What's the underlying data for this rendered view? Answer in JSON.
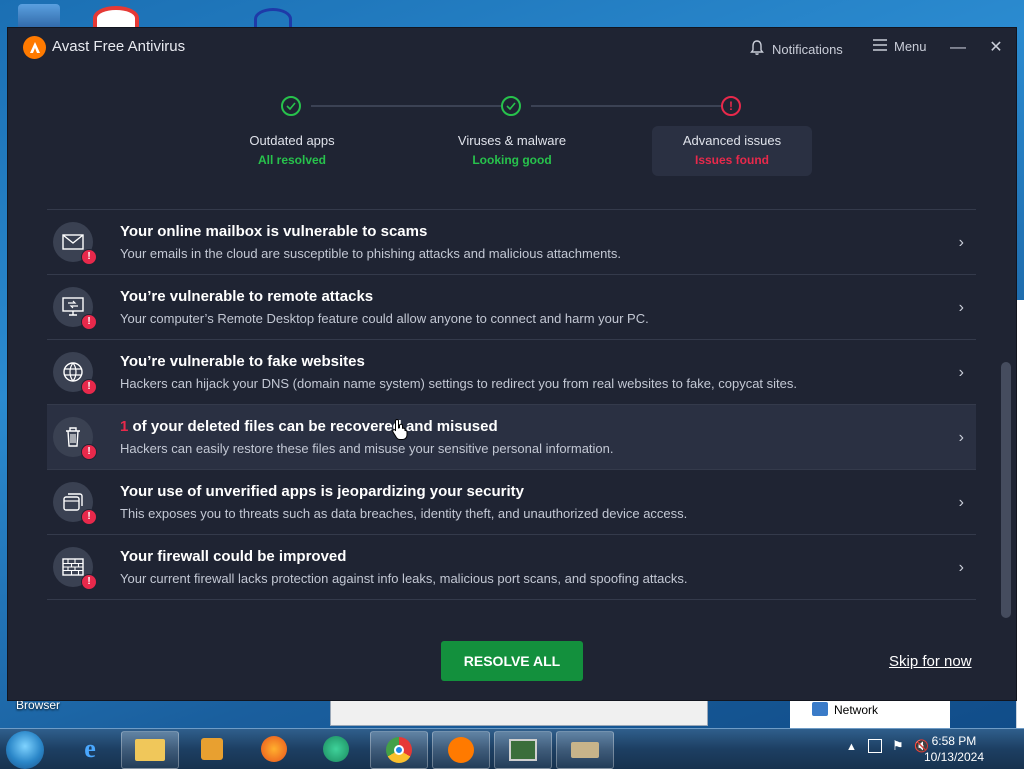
{
  "app": {
    "title": "Avast Free Antivirus",
    "notifications_label": "Notifications",
    "menu_label": "Menu"
  },
  "steps": [
    {
      "title": "Outdated apps",
      "status": "All resolved",
      "status_color": "#27c24c"
    },
    {
      "title": "Viruses & malware",
      "status": "Looking good",
      "status_color": "#27c24c"
    },
    {
      "title": "Advanced issues",
      "status": "Issues found",
      "status_color": "#e8294b"
    }
  ],
  "issues": [
    {
      "icon": "mail-icon",
      "title": "Your online mailbox is vulnerable to scams",
      "desc": "Your emails in the cloud are susceptible to phishing attacks and malicious attachments."
    },
    {
      "icon": "remote-desktop-icon",
      "title": "You’re vulnerable to remote attacks",
      "desc": "Your computer’s Remote Desktop feature could allow anyone to connect and harm your PC."
    },
    {
      "icon": "globe-icon",
      "title": "You’re vulnerable to fake websites",
      "desc": "Hackers can hijack your DNS (domain name system) settings to redirect you from real websites to fake, copycat sites."
    },
    {
      "icon": "trash-icon",
      "count": "1",
      "title": " of your deleted files can be recovered and misused",
      "desc": "Hackers can easily restore these files and misuse your sensitive personal information."
    },
    {
      "icon": "apps-icon",
      "title": "Your use of unverified apps is jeopardizing your security",
      "desc": "This exposes you to threats such as data breaches, identity theft, and unauthorized device access."
    },
    {
      "icon": "firewall-icon",
      "title": "Your firewall could be improved",
      "desc": "Your current firewall lacks protection against info leaks, malicious port scans, and spoofing attacks."
    }
  ],
  "actions": {
    "resolve_all": "RESOLVE ALL",
    "skip": "Skip for now"
  },
  "desktop": {
    "browser_label": "Browser",
    "network_label": "Network"
  },
  "taskbar": {
    "time": "6:58 PM",
    "date": "10/13/2024",
    "items": [
      "internet-explorer-icon",
      "file-explorer-icon",
      "media-player-icon",
      "firefox-icon",
      "app-icon",
      "chrome-icon",
      "avast-icon",
      "task-manager-icon",
      "scanner-icon"
    ]
  },
  "colors": {
    "accent_green": "#13903d",
    "alert_red": "#e8294b",
    "brand_orange": "#ff7a00",
    "background": "#1f2433"
  }
}
